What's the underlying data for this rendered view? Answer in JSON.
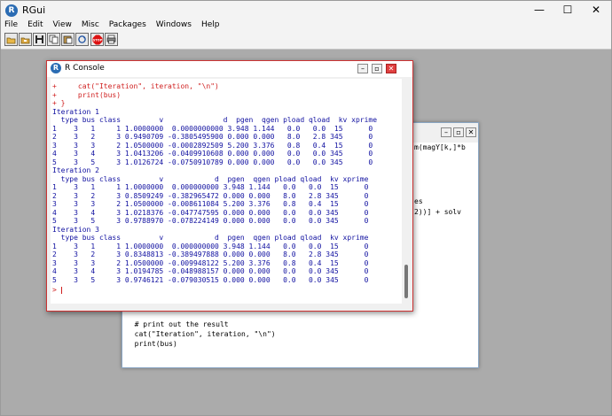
{
  "app": {
    "title": "RGui",
    "logo": "R"
  },
  "menu": [
    "File",
    "Edit",
    "View",
    "Misc",
    "Packages",
    "Windows",
    "Help"
  ],
  "toolbar": [
    {
      "icon": "open-icon",
      "glyph": "📂"
    },
    {
      "icon": "load-workspace-icon",
      "glyph": "📁"
    },
    {
      "icon": "save-icon",
      "glyph": "💾"
    },
    {
      "icon": "copy-icon",
      "glyph": "⧉"
    },
    {
      "icon": "paste-icon",
      "glyph": "📋"
    },
    {
      "icon": "copy-paste-icon",
      "glyph": "↻"
    },
    {
      "icon": "stop-icon",
      "glyph": "STOP"
    },
    {
      "icon": "print-icon",
      "glyph": "🖶"
    }
  ],
  "main_controls": {
    "minimize": "—",
    "maximize": "☐",
    "close": "✕"
  },
  "console": {
    "title": "R Console",
    "controls": {
      "minimize": "–",
      "maximize": "▫",
      "close": "✕"
    },
    "lines": [
      {
        "t": "+     cat(\"Iteration\", iteration, \"\\n\")",
        "cmd": true
      },
      {
        "t": "+     print(bus)",
        "cmd": true
      },
      {
        "t": "+ }",
        "cmd": true
      },
      {
        "t": "Iteration 1",
        "cmd": false
      },
      {
        "t": "  type bus class         v              d  pgen  qgen pload qload  kv xprime",
        "cmd": false
      },
      {
        "t": "1    3   1     1 1.0000000  0.0000000000 3.948 1.144   0.0   0.0  15      0",
        "cmd": false
      },
      {
        "t": "2    3   2     3 0.9490709 -0.3805495900 0.000 0.000   8.0   2.8 345      0",
        "cmd": false
      },
      {
        "t": "3    3   3     2 1.0500000 -0.0002892509 5.200 3.376   0.8   0.4  15      0",
        "cmd": false
      },
      {
        "t": "4    3   4     3 1.0413206 -0.0409910608 0.000 0.000   0.0   0.0 345      0",
        "cmd": false
      },
      {
        "t": "5    3   5     3 1.0126724 -0.0750910789 0.000 0.000   0.0   0.0 345      0",
        "cmd": false
      },
      {
        "t": "Iteration 2",
        "cmd": false
      },
      {
        "t": "  type bus class         v            d  pgen  qgen pload qload  kv xprime",
        "cmd": false
      },
      {
        "t": "1    3   1     1 1.0000000  0.000000000 3.948 1.144   0.0   0.0  15      0",
        "cmd": false
      },
      {
        "t": "2    3   2     3 0.8509249 -0.382965472 0.000 0.000   8.0   2.8 345      0",
        "cmd": false
      },
      {
        "t": "3    3   3     2 1.0500000 -0.008611084 5.200 3.376   0.8   0.4  15      0",
        "cmd": false
      },
      {
        "t": "4    3   4     3 1.0218376 -0.047747595 0.000 0.000   0.0   0.0 345      0",
        "cmd": false
      },
      {
        "t": "5    3   5     3 0.9788970 -0.078224149 0.000 0.000   0.0   0.0 345      0",
        "cmd": false
      },
      {
        "t": "Iteration 3",
        "cmd": false
      },
      {
        "t": "  type bus class         v            d  pgen  qgen pload qload  kv xprime",
        "cmd": false
      },
      {
        "t": "1    3   1     1 1.0000000  0.000000000 3.948 1.144   0.0   0.0  15      0",
        "cmd": false
      },
      {
        "t": "2    3   2     3 0.8348813 -0.389497888 0.000 0.000   8.0   2.8 345      0",
        "cmd": false
      },
      {
        "t": "3    3   3     2 1.0500000 -0.009948122 5.200 3.376   0.8   0.4  15      0",
        "cmd": false
      },
      {
        "t": "4    3   4     3 1.0194785 -0.048988157 0.000 0.000   0.0   0.0 345      0",
        "cmd": false
      },
      {
        "t": "5    3   5     3 0.9746121 -0.079030515 0.000 0.000   0.0   0.0 345      0",
        "cmd": false
      }
    ],
    "prompt": ">"
  },
  "editor": {
    "title": "",
    "visible_fragments": {
      "f1": "m(magY[k,]*b",
      "f2": "es",
      "f3": "2))] + solv"
    },
    "code_lines": [
      "  # print out the result",
      "  cat(\"Iteration\", iteration, \"\\n\")",
      "  print(bus)",
      "}"
    ]
  }
}
